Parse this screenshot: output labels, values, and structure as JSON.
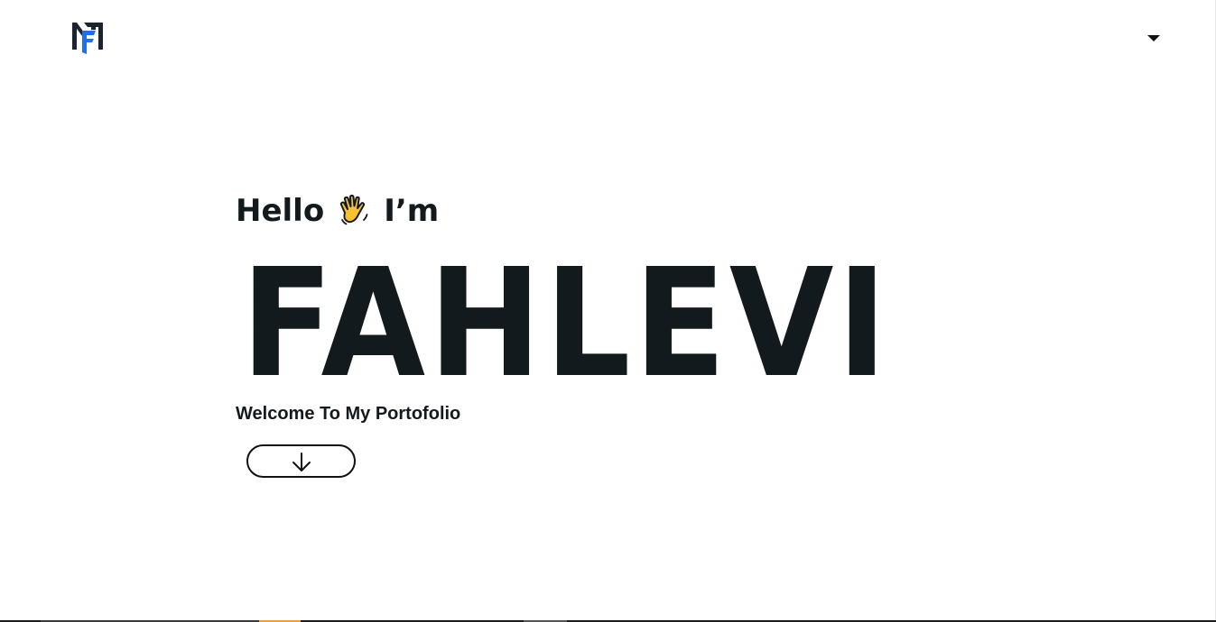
{
  "header": {
    "logo_icon": "fahlevi-logo-icon",
    "menu_icon": "caret-down-icon"
  },
  "hero": {
    "greeting_before": "Hello",
    "wave_icon": "waving-hand-icon",
    "greeting_after": "I’m",
    "name": "FAHLEVI",
    "welcome": "Welcome To My Portofolio",
    "scroll_icon": "arrow-down-icon"
  },
  "colors": {
    "text": "#131a1d",
    "background": "#ffffff",
    "logo_dark": "#1b2430",
    "logo_blue": "#1e6fe8",
    "wave_fill": "#f7c12f"
  }
}
